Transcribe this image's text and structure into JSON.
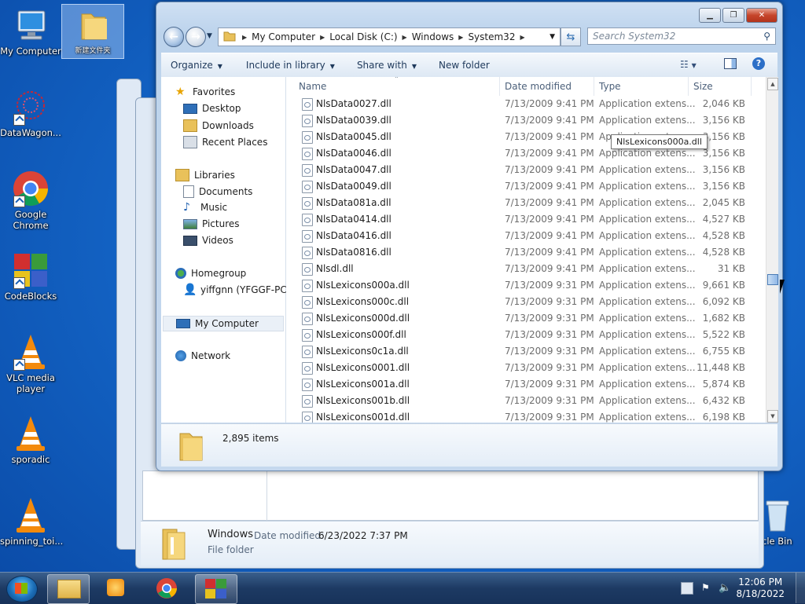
{
  "desktop": {
    "icons": [
      {
        "label": "My Computer",
        "icon": "computer-icon"
      },
      {
        "label": "新建文件夹",
        "icon": "folder-icon"
      },
      {
        "label": "DataWagon...",
        "icon": "datawagon-icon"
      },
      {
        "label": "Google Chrome",
        "icon": "chrome-icon"
      },
      {
        "label": "CodeBlocks",
        "icon": "codeblocks-icon"
      },
      {
        "label": "VLC media player",
        "icon": "vlc-icon"
      },
      {
        "label": "sporadic",
        "icon": "vlc-icon"
      },
      {
        "label": "spinning_toi...",
        "icon": "vlc-icon"
      },
      {
        "label": "cle Bin",
        "icon": "recycle-bin-icon"
      }
    ]
  },
  "explorer": {
    "breadcrumb": [
      "My Computer",
      "Local Disk (C:)",
      "Windows",
      "System32"
    ],
    "search_placeholder": "Search System32",
    "toolbar": {
      "organize": "Organize",
      "include": "Include in library",
      "share": "Share with",
      "new_folder": "New folder"
    },
    "nav": {
      "favorites": "Favorites",
      "desktop": "Desktop",
      "downloads": "Downloads",
      "recent": "Recent Places",
      "libraries": "Libraries",
      "documents": "Documents",
      "music": "Music",
      "pictures": "Pictures",
      "videos": "Videos",
      "homegroup": "Homegroup",
      "user": "yiffgnn (YFGGF-PC)",
      "mycomputer": "My Computer",
      "network": "Network"
    },
    "columns": {
      "name": "Name",
      "date": "Date modified",
      "type": "Type",
      "size": "Size"
    },
    "files": [
      {
        "name": "NlsData0027.dll",
        "date": "7/13/2009 9:41 PM",
        "type": "Application extens...",
        "size": "2,046 KB"
      },
      {
        "name": "NlsData0039.dll",
        "date": "7/13/2009 9:41 PM",
        "type": "Application extens...",
        "size": "3,156 KB"
      },
      {
        "name": "NlsData0045.dll",
        "date": "7/13/2009 9:41 PM",
        "type": "Application extens...",
        "size": "3,156 KB"
      },
      {
        "name": "NlsData0046.dll",
        "date": "7/13/2009 9:41 PM",
        "type": "Application extens...",
        "size": "3,156 KB"
      },
      {
        "name": "NlsData0047.dll",
        "date": "7/13/2009 9:41 PM",
        "type": "Application extens...",
        "size": "3,156 KB"
      },
      {
        "name": "NlsData0049.dll",
        "date": "7/13/2009 9:41 PM",
        "type": "Application extens...",
        "size": "3,156 KB"
      },
      {
        "name": "NlsData081a.dll",
        "date": "7/13/2009 9:41 PM",
        "type": "Application extens...",
        "size": "2,045 KB"
      },
      {
        "name": "NlsData0414.dll",
        "date": "7/13/2009 9:41 PM",
        "type": "Application extens...",
        "size": "4,527 KB"
      },
      {
        "name": "NlsData0416.dll",
        "date": "7/13/2009 9:41 PM",
        "type": "Application extens...",
        "size": "4,528 KB"
      },
      {
        "name": "NlsData0816.dll",
        "date": "7/13/2009 9:41 PM",
        "type": "Application extens...",
        "size": "4,528 KB"
      },
      {
        "name": "Nlsdl.dll",
        "date": "7/13/2009 9:41 PM",
        "type": "Application extens...",
        "size": "31 KB"
      },
      {
        "name": "NlsLexicons000a.dll",
        "date": "7/13/2009 9:31 PM",
        "type": "Application extens...",
        "size": "9,661 KB"
      },
      {
        "name": "NlsLexicons000c.dll",
        "date": "7/13/2009 9:31 PM",
        "type": "Application extens...",
        "size": "6,092 KB"
      },
      {
        "name": "NlsLexicons000d.dll",
        "date": "7/13/2009 9:31 PM",
        "type": "Application extens...",
        "size": "1,682 KB"
      },
      {
        "name": "NlsLexicons000f.dll",
        "date": "7/13/2009 9:31 PM",
        "type": "Application extens...",
        "size": "5,522 KB"
      },
      {
        "name": "NlsLexicons0c1a.dll",
        "date": "7/13/2009 9:31 PM",
        "type": "Application extens...",
        "size": "6,755 KB"
      },
      {
        "name": "NlsLexicons0001.dll",
        "date": "7/13/2009 9:31 PM",
        "type": "Application extens...",
        "size": "11,448 KB"
      },
      {
        "name": "NlsLexicons001a.dll",
        "date": "7/13/2009 9:31 PM",
        "type": "Application extens...",
        "size": "5,874 KB"
      },
      {
        "name": "NlsLexicons001b.dll",
        "date": "7/13/2009 9:31 PM",
        "type": "Application extens...",
        "size": "6,432 KB"
      },
      {
        "name": "NlsLexicons001d.dll",
        "date": "7/13/2009 9:31 PM",
        "type": "Application extens...",
        "size": "6,198 KB"
      }
    ],
    "tooltip": "NlsLexicons000a.dll",
    "item_count": "2,895 items"
  },
  "background_window": {
    "folder_name": "Windows",
    "date_label": "Date modified:",
    "date_value": "6/23/2022 7:37 PM",
    "kind": "File folder"
  },
  "taskbar": {
    "time": "12:06 PM",
    "date": "8/18/2022"
  },
  "colors": {
    "accent": "#1466c8",
    "selection": "#cde8ff"
  }
}
